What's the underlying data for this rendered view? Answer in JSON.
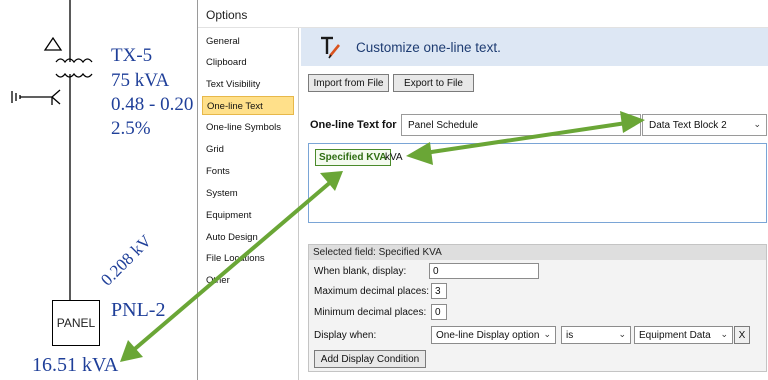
{
  "diagram": {
    "transformer_name": "TX-5",
    "transformer_kva": "75 kVA",
    "transformer_voltage": "0.48 - 0.20",
    "transformer_impedance": "2.5%",
    "bus_voltage": "0.208 kV",
    "panel_box_label": "PANEL",
    "panel_name": "PNL-2",
    "panel_kva": "16.51 kVA"
  },
  "dialog": {
    "title": "Options",
    "nav_items": [
      "General",
      "Clipboard",
      "Text Visibility",
      "One-line Text",
      "One-line Symbols",
      "Grid",
      "Fonts",
      "System",
      "Equipment",
      "Auto Design",
      "File Locations",
      "Other"
    ],
    "active_nav": "One-line Text",
    "header_title": "Customize one-line text.",
    "import_button": "Import from File",
    "export_button": "Export to File",
    "one_line_text_for_label": "One-line Text for",
    "one_line_text_for_value": "Panel Schedule",
    "text_block_value": "Data Text Block 2",
    "field_token": "Specified KVA",
    "field_suffix": "kVA",
    "selected_field": {
      "header": "Selected field: Specified KVA",
      "when_blank_label": "When blank, display:",
      "when_blank_value": "0",
      "max_decimals_label": "Maximum decimal places:",
      "max_decimals_value": "3",
      "min_decimals_label": "Minimum decimal places:",
      "min_decimals_value": "0",
      "display_when_label": "Display when:",
      "condition_field": "One-line Display option",
      "condition_operator": "is",
      "condition_value": "Equipment Data",
      "remove_condition_label": "X",
      "add_condition_button": "Add Display Condition"
    }
  },
  "colors": {
    "diagram_text": "#1f3f99",
    "arrow": "#6aa636",
    "active_nav_bg": "#ffe08a",
    "header_band": "#dde7f4",
    "field_token_text": "#2f6e12"
  },
  "icons": {
    "header_icon": "text-pen-icon",
    "dropdown": "chevron-down-icon"
  }
}
